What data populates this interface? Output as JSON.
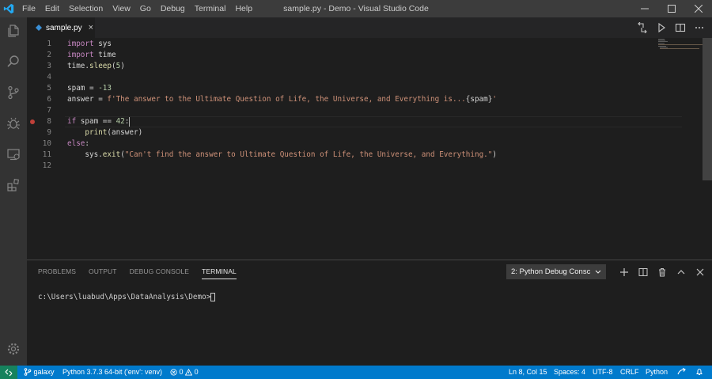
{
  "titlebar": {
    "menu": [
      "File",
      "Edit",
      "Selection",
      "View",
      "Go",
      "Debug",
      "Terminal",
      "Help"
    ],
    "title": "sample.py - Demo - Visual Studio Code"
  },
  "tab": {
    "label": "sample.py",
    "close": "×"
  },
  "editor": {
    "line_numbers": [
      "1",
      "2",
      "3",
      "4",
      "5",
      "6",
      "7",
      "8",
      "9",
      "10",
      "11",
      "12"
    ],
    "lines": [
      {
        "parts": [
          {
            "t": "import ",
            "c": "kw"
          },
          {
            "t": "sys",
            "c": "var"
          }
        ]
      },
      {
        "parts": [
          {
            "t": "import ",
            "c": "kw"
          },
          {
            "t": "time",
            "c": "var"
          }
        ]
      },
      {
        "parts": [
          {
            "t": "time",
            "c": "var"
          },
          {
            "t": ".",
            "c": "var"
          },
          {
            "t": "sleep",
            "c": "fn"
          },
          {
            "t": "(",
            "c": "var"
          },
          {
            "t": "5",
            "c": "num"
          },
          {
            "t": ")",
            "c": "var"
          }
        ]
      },
      {
        "parts": []
      },
      {
        "parts": [
          {
            "t": "spam",
            "c": "var"
          },
          {
            "t": " = ",
            "c": "var"
          },
          {
            "t": "-13",
            "c": "num"
          }
        ]
      },
      {
        "parts": [
          {
            "t": "answer",
            "c": "var"
          },
          {
            "t": " = ",
            "c": "var"
          },
          {
            "t": "f'The answer to the Ultimate Question of Life, the Universe, and Everything is...",
            "c": "str"
          },
          {
            "t": "{spam}",
            "c": "var"
          },
          {
            "t": "'",
            "c": "str"
          }
        ]
      },
      {
        "parts": []
      },
      {
        "parts": [
          {
            "t": "if ",
            "c": "kw"
          },
          {
            "t": "spam",
            "c": "var"
          },
          {
            "t": " == ",
            "c": "var"
          },
          {
            "t": "42",
            "c": "num"
          },
          {
            "t": ":",
            "c": "var"
          }
        ]
      },
      {
        "parts": [
          {
            "t": "    ",
            "c": "var"
          },
          {
            "t": "print",
            "c": "fn"
          },
          {
            "t": "(answer)",
            "c": "var"
          }
        ]
      },
      {
        "parts": [
          {
            "t": "else",
            "c": "kw"
          },
          {
            "t": ":",
            "c": "var"
          }
        ]
      },
      {
        "parts": [
          {
            "t": "    sys",
            "c": "var"
          },
          {
            "t": ".",
            "c": "var"
          },
          {
            "t": "exit",
            "c": "fn"
          },
          {
            "t": "(",
            "c": "var"
          },
          {
            "t": "\"Can't find the answer to Ultimate Question of Life, the Universe, and Everything.\"",
            "c": "str"
          },
          {
            "t": ")",
            "c": "var"
          }
        ]
      },
      {
        "parts": []
      }
    ]
  },
  "panel": {
    "tabs": [
      "PROBLEMS",
      "OUTPUT",
      "DEBUG CONSOLE",
      "TERMINAL"
    ],
    "active_tab": "TERMINAL",
    "terminal_select": "2: Python Debug Consc",
    "terminal_prompt": "c:\\Users\\luabud\\Apps\\DataAnalysis\\Demo>"
  },
  "statusbar": {
    "branch": "galaxy",
    "interpreter": "Python 3.7.3 64-bit ('env': venv)",
    "errors": "0",
    "warnings": "0",
    "position": "Ln 8, Col 15",
    "spaces": "Spaces: 4",
    "encoding": "UTF-8",
    "eol": "CRLF",
    "language": "Python"
  },
  "colors": {
    "statusbar": "#007acc",
    "remote": "#16825d",
    "activitybar": "#333333",
    "titlebar": "#3c3c3c",
    "breakpoint": "#c04039"
  }
}
